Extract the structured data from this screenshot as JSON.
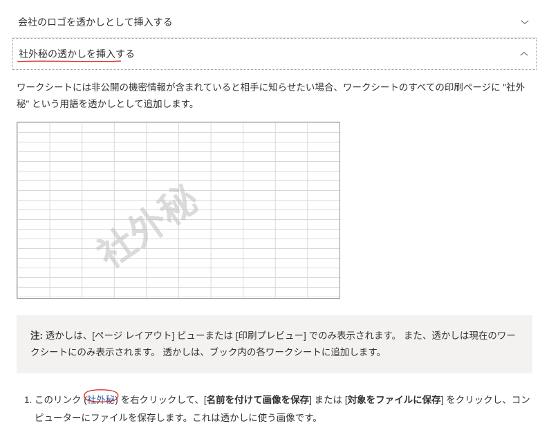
{
  "accordion1": {
    "title": "会社のロゴを透かしとして挿入する"
  },
  "accordion2": {
    "title": "社外秘の透かしを挿入する"
  },
  "intro_paragraph": "ワークシートには非公開の機密情報が含まれていると相手に知らせたい場合、ワークシートのすべての印刷ページに \"社外秘\" という用語を透かしとして追加します。",
  "watermark_text": "社外秘",
  "note": {
    "label": "注: ",
    "text": "透かしは、[ページ レイアウト] ビューまたは [印刷プレビュー] でのみ表示されます。 また、透かしは現在のワークシートにのみ表示されます。 透かしは、ブック内の各ワークシートに追加します。"
  },
  "step1": {
    "part1": "このリンク (",
    "link": "社外秘",
    "part2": ") を右クリックして、[",
    "bold1": "名前を付けて画像を保存",
    "part3": "] または [",
    "bold2": "対象をファイルに保存",
    "part4": "] をクリックし、コンピューターにファイルを保存します。これは透かしに使う画像です。"
  }
}
